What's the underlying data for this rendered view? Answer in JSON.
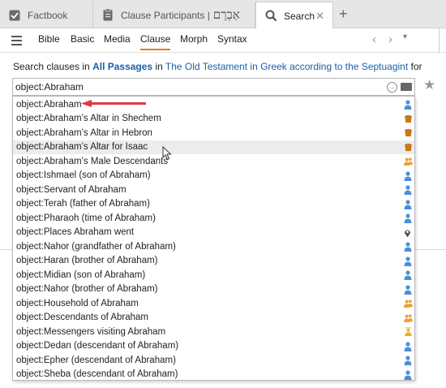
{
  "tabs": [
    {
      "label": "Factbook",
      "icon": "factbook-icon"
    },
    {
      "label": "Clause Participants |",
      "hebrew": "אַבְרָם",
      "icon": "document-icon"
    },
    {
      "label": "Search",
      "icon": "search-icon",
      "close": "✕"
    }
  ],
  "new_tab": "+",
  "toolbar": {
    "tabs": [
      "Bible",
      "Basic",
      "Media",
      "Clause",
      "Morph",
      "Syntax"
    ],
    "selected": "Clause",
    "back": "‹",
    "forward": "›",
    "history": "▾"
  },
  "search": {
    "prefix": "Search clauses in ",
    "passages": "All Passages",
    "in": " in ",
    "corpus": "The Old Testament in Greek according to the Septuagint",
    "suffix": " for",
    "query": "object:Abraham",
    "go": "→"
  },
  "suggestions": [
    {
      "text": "object:Abraham",
      "icon": "person-icon",
      "color": "#4a90d9"
    },
    {
      "text": "object:Abraham’s Altar in Shechem",
      "icon": "altar-icon",
      "color": "#c9771c"
    },
    {
      "text": "object:Abraham’s Altar in Hebron",
      "icon": "altar-icon",
      "color": "#c9771c"
    },
    {
      "text": "object:Abraham’s Altar for Isaac",
      "icon": "altar-icon",
      "color": "#c9771c"
    },
    {
      "text": "object:Abraham’s Male Descendants",
      "icon": "group-icon",
      "color": "#e8a33a"
    },
    {
      "text": "object:Ishmael (son of Abraham)",
      "icon": "person-icon",
      "color": "#4a90d9"
    },
    {
      "text": "object:Servant of Abraham",
      "icon": "person-icon",
      "color": "#4a90d9"
    },
    {
      "text": "object:Terah (father of Abraham)",
      "icon": "person-icon",
      "color": "#4a90d9"
    },
    {
      "text": "object:Pharaoh (time of Abraham)",
      "icon": "person-icon",
      "color": "#4a90d9"
    },
    {
      "text": "object:Places Abraham went",
      "icon": "map-pin-icon",
      "color": "#555555"
    },
    {
      "text": "object:Nahor (grandfather of Abraham)",
      "icon": "person-icon",
      "color": "#4a90d9"
    },
    {
      "text": "object:Haran (brother of Abraham)",
      "icon": "person-icon",
      "color": "#4a90d9"
    },
    {
      "text": "object:Midian (son of Abraham)",
      "icon": "person-icon",
      "color": "#4a90d9"
    },
    {
      "text": "object:Nahor (brother of Abraham)",
      "icon": "person-icon",
      "color": "#4a90d9"
    },
    {
      "text": "object:Household of Abraham",
      "icon": "group-icon",
      "color": "#e8a33a"
    },
    {
      "text": "object:Descendants of Abraham",
      "icon": "group-icon",
      "color": "#e8a33a"
    },
    {
      "text": "object:Messengers visiting Abraham",
      "icon": "angel-icon",
      "color": "#e3b21f"
    },
    {
      "text": "object:Dedan (descendant of Abraham)",
      "icon": "person-icon",
      "color": "#4a90d9"
    },
    {
      "text": "object:Epher (descendant of Abraham)",
      "icon": "person-icon",
      "color": "#4a90d9"
    },
    {
      "text": "object:Sheba (descendant of Abraham)",
      "icon": "person-icon",
      "color": "#4a90d9"
    }
  ],
  "highlighted_index": 3,
  "accent": "#d9821e",
  "link_color": "#1a5fa8",
  "annotation_arrow_color": "#e0393e"
}
